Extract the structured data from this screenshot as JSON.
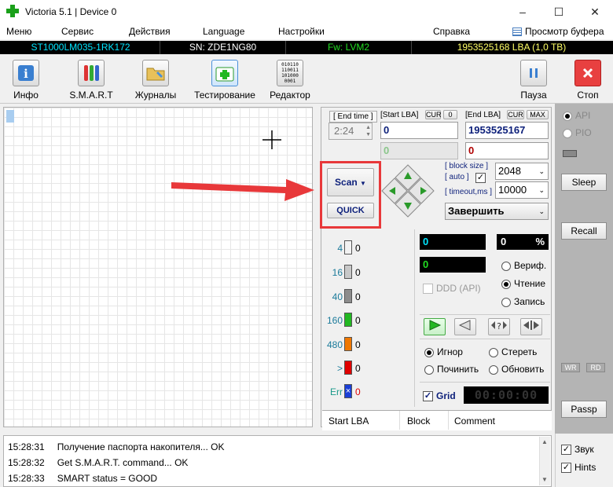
{
  "window": {
    "title": "Victoria 5.1 | Device 0"
  },
  "menu": {
    "items": [
      "Меню",
      "Сервис",
      "Действия",
      "Language",
      "Настройки",
      "Справка"
    ],
    "buffer_view": "Просмотр буфера"
  },
  "info": {
    "model": "ST1000LM035-1RK172",
    "serial": "SN: ZDE1NG80",
    "firmware": "Fw: LVM2",
    "capacity": "1953525168 LBA (1,0 TB)"
  },
  "toolbar": {
    "info": "Инфо",
    "smart": "S.M.A.R.T",
    "logs": "Журналы",
    "testing": "Тестирование",
    "editor": "Редактор",
    "pause": "Пауза",
    "stop": "Стоп",
    "editor_icon_text": [
      "010110",
      "110011",
      "101000",
      "0001"
    ]
  },
  "scan": {
    "end_time_label": "[ End time ]",
    "end_time_value": "2:24",
    "start_lba_label": "[Start LBA]",
    "cur_label": "CUR",
    "cur_value": "0",
    "end_lba_label": "[End LBA]",
    "end_cur_label": "CUR",
    "max_label": "MAX",
    "start_lba_value": "0",
    "end_lba_value": "1953525167",
    "start_lba_secondary": "0",
    "end_lba_secondary": "0",
    "scan_button": "Scan",
    "quick_button": "QUICK",
    "block_size_label": "[ block size ]",
    "auto_label": "[ auto ]",
    "block_size_value": "2048",
    "timeout_label": "[ timeout,ms ]",
    "timeout_value": "10000",
    "finish_select": "Завершить"
  },
  "stats": {
    "legend": [
      {
        "label": "4",
        "count": "0",
        "color": "#f2f2f2"
      },
      {
        "label": "16",
        "count": "0",
        "color": "#c8c8c8"
      },
      {
        "label": "40",
        "count": "0",
        "color": "#8c8c8c"
      },
      {
        "label": "160",
        "count": "0",
        "color": "#22b822"
      },
      {
        "label": "480",
        "count": "0",
        "color": "#f07800"
      },
      {
        "label": ">",
        "count": "0",
        "color": "#e00000"
      },
      {
        "label": "Err",
        "count": "0",
        "color": "#1a3fd6"
      }
    ],
    "counter_value": "0",
    "percent_value": "0",
    "percent_sign": "%",
    "speed_value": "0",
    "ddd_label": "DDD (API)",
    "verify": "Вериф.",
    "read": "Чтение",
    "write": "Запись",
    "ignore": "Игнор",
    "erase": "Стереть",
    "repair": "Починить",
    "refresh": "Обновить",
    "grid": "Grid",
    "timer": "00:00:00"
  },
  "table": {
    "columns": [
      "Start LBA",
      "Block",
      "Comment"
    ]
  },
  "sidebar": {
    "api": "API",
    "pio": "PIO",
    "sleep": "Sleep",
    "recall": "Recall",
    "wr": "WR",
    "rd": "RD",
    "passp": "Passp",
    "sound": "Звук",
    "hints": "Hints"
  },
  "log": [
    {
      "time": "15:28:31",
      "text": "Получение паспорта накопителя... OK"
    },
    {
      "time": "15:28:32",
      "text": "Get S.M.A.R.T. command... OK"
    },
    {
      "time": "15:28:33",
      "text": "SMART status = GOOD"
    }
  ],
  "colors": {
    "accent_red": "#e8383a",
    "cyan_text": "#00e5ff",
    "green_text": "#22dd22",
    "yellow_text": "#ffff66"
  }
}
